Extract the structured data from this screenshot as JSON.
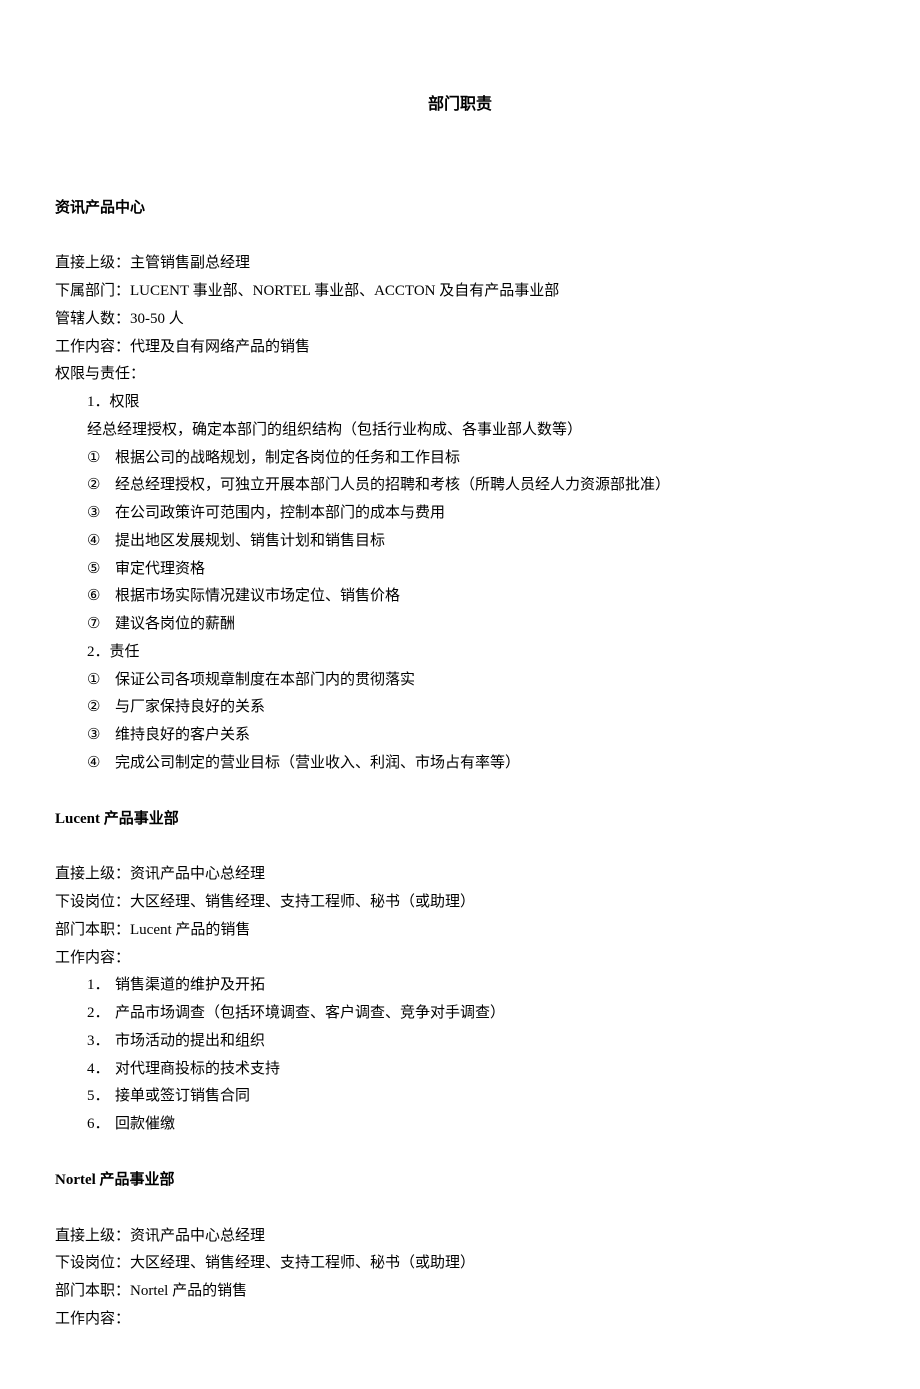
{
  "title": "部门职责",
  "sections": [
    {
      "heading": "资讯产品中心",
      "fields": [
        "直接上级：主管销售副总经理",
        "下属部门：LUCENT 事业部、NORTEL 事业部、ACCTON 及自有产品事业部",
        "管辖人数：30-50 人",
        "工作内容：代理及自有网络产品的销售",
        "权限与责任："
      ],
      "auth_label": "1．权限",
      "auth_intro": "经总经理授权，确定本部门的组织结构（包括行业构成、各事业部人数等）",
      "auth_items": [
        "根据公司的战略规划，制定各岗位的任务和工作目标",
        "经总经理授权，可独立开展本部门人员的招聘和考核（所聘人员经人力资源部批准）",
        "在公司政策许可范围内，控制本部门的成本与费用",
        "提出地区发展规划、销售计划和销售目标",
        "审定代理资格",
        "根据市场实际情况建议市场定位、销售价格",
        "建议各岗位的薪酬"
      ],
      "resp_label": "2．责任",
      "resp_items": [
        "保证公司各项规章制度在本部门内的贯彻落实",
        "与厂家保持良好的关系",
        "维持良好的客户关系",
        "完成公司制定的营业目标（营业收入、利润、市场占有率等）"
      ]
    },
    {
      "heading": "Lucent 产品事业部",
      "fields": [
        "直接上级：资讯产品中心总经理",
        "下设岗位：大区经理、销售经理、支持工程师、秘书（或助理）",
        "部门本职：Lucent 产品的销售",
        "工作内容："
      ],
      "work_items": [
        "销售渠道的维护及开拓",
        "产品市场调查（包括环境调查、客户调查、竞争对手调查）",
        "市场活动的提出和组织",
        "对代理商投标的技术支持",
        "接单或签订销售合同",
        "回款催缴"
      ]
    },
    {
      "heading": "Nortel 产品事业部",
      "fields": [
        "直接上级：资讯产品中心总经理",
        "下设岗位：大区经理、销售经理、支持工程师、秘书（或助理）",
        "部门本职：Nortel 产品的销售",
        "工作内容："
      ]
    }
  ],
  "circled": [
    "①",
    "②",
    "③",
    "④",
    "⑤",
    "⑥",
    "⑦"
  ]
}
